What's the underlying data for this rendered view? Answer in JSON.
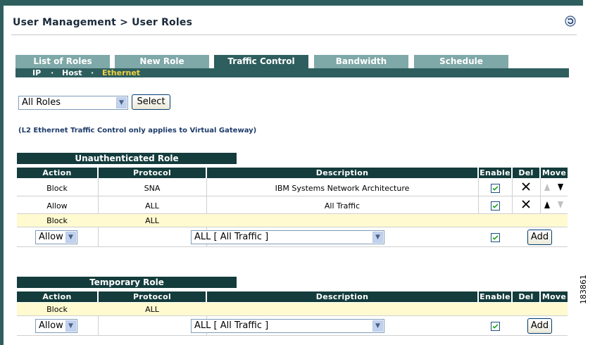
{
  "header": {
    "breadcrumb": "User Management > User Roles"
  },
  "tabs": [
    {
      "label": "List of Roles"
    },
    {
      "label": "New Role"
    },
    {
      "label": "Traffic Control"
    },
    {
      "label": "Bandwidth"
    },
    {
      "label": "Schedule"
    }
  ],
  "active_tab": "Traffic Control",
  "subnav": {
    "items": [
      "IP",
      "Host",
      "Ethernet"
    ],
    "separator": "·",
    "active": "Ethernet"
  },
  "role_select": {
    "value": "All Roles",
    "button_label": "Select"
  },
  "note": "(L2 Ethernet Traffic Control only applies to Virtual Gateway)",
  "columns": {
    "action": "Action",
    "protocol": "Protocol",
    "description": "Description",
    "enable": "Enable",
    "del": "Del",
    "move": "Move"
  },
  "unauth_section": {
    "title": "Unauthenticated Role",
    "rows": [
      {
        "action": "Block",
        "protocol": "SNA",
        "description": "IBM Systems Network Architecture",
        "enabled": true
      },
      {
        "action": "Allow",
        "protocol": "ALL",
        "description": "All Traffic",
        "enabled": true
      }
    ],
    "default_row": {
      "action": "Block",
      "protocol": "ALL"
    },
    "add_row": {
      "action_value": "Allow",
      "protocol_value": "ALL [ All Traffic ]",
      "enabled": true,
      "add_label": "Add"
    }
  },
  "temp_section": {
    "title": "Temporary Role",
    "default_row": {
      "action": "Block",
      "protocol": "ALL"
    },
    "add_row": {
      "action_value": "Allow",
      "protocol_value": "ALL [ All Traffic ]",
      "enabled": true,
      "add_label": "Add"
    }
  },
  "figure_id": "183861",
  "colors": {
    "dark_teal": "#143c3c",
    "tab_teal": "#7fa8a8",
    "active_tab": "#2e5e5e",
    "highlight_row": "#fffad0",
    "subnav_active": "#f0d040"
  }
}
